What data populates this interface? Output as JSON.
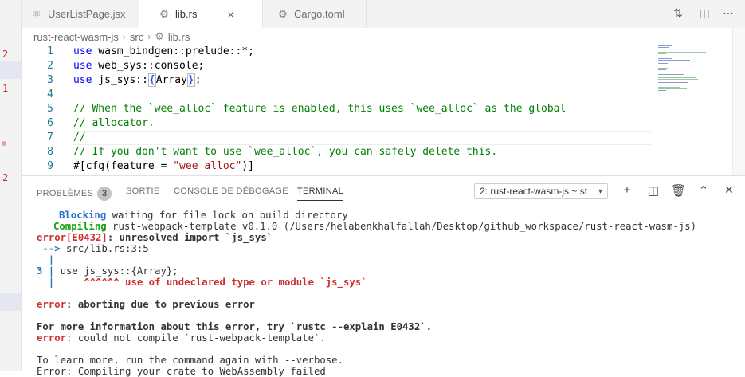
{
  "gutter": {
    "marks": [
      "2",
      "1",
      "2"
    ]
  },
  "tabs": [
    {
      "label": "UserListPage.jsx",
      "icon": "react-file-icon",
      "active": false
    },
    {
      "label": "lib.rs",
      "icon": "rust-file-icon",
      "active": true
    },
    {
      "label": "Cargo.toml",
      "icon": "gear-file-icon",
      "active": false
    }
  ],
  "tab_close_glyph": "×",
  "breadcrumb": {
    "project": "rust-react-wasm-js",
    "folder": "src",
    "file": "lib.rs",
    "separator": "›"
  },
  "editor": {
    "line_numbers": [
      "1",
      "2",
      "3",
      "4",
      "5",
      "6",
      "7",
      "8",
      "9"
    ],
    "lines": {
      "l1": {
        "kw": "use",
        "rest": " wasm_bindgen::prelude::*;"
      },
      "l2": {
        "kw": "use",
        "rest": " web_sys::console;"
      },
      "l3": {
        "kw": "use",
        "pre": " js_sys::",
        "open": "{",
        "name": "Array",
        "close": "}",
        "end": ";"
      },
      "l5": "// When the `wee_alloc` feature is enabled, this uses `wee_alloc` as the global",
      "l6": "// allocator.",
      "l7": "//",
      "l8": "// If you don't want to use `wee_alloc`, you can safely delete this.",
      "l9": {
        "pre": "#[cfg(feature = ",
        "str": "\"wee_alloc\"",
        "end": ")]"
      }
    }
  },
  "panel": {
    "tabs": {
      "problems": "PROBLÈMES",
      "problems_count": "3",
      "output": "SORTIE",
      "debug": "CONSOLE DE DÉBOGAGE",
      "terminal": "TERMINAL"
    },
    "terminal_select": "2: rust-react-wasm-js ~ st",
    "terminal_select_icon": "chevron-down-icon",
    "terminal_lines": {
      "t1_kw": "Blocking",
      "t1_rest": " waiting for file lock on build directory",
      "t2_kw": "Compiling",
      "t2_rest": " rust-webpack-template v0.1.0 (/Users/helabenkhalfallah/Desktop/github_workspace/rust-react-wasm-js)",
      "t3_kw": "error[E0432]",
      "t3_rest": ": unresolved import `js_sys`",
      "t4_arrow": " -->",
      "t4_rest": " src/lib.rs:3:5",
      "t5": "  |",
      "t6_num": "3",
      "t6_bar": " |",
      "t6_rest": " use js_sys::{Array};",
      "t7_bar": "  |",
      "t7_rest": "     ^^^^^^ use of undeclared type or module `js_sys`",
      "t8_kw": "error",
      "t8_rest": ": aborting due to previous error",
      "t9": "For more information about this error, try `rustc --explain E0432`.",
      "t10_kw": "error",
      "t10_rest": ": could not compile `rust-webpack-template`.",
      "t11": "To learn more, run the command again with --verbose.",
      "t12": "Error: Compiling your crate to WebAssembly failed"
    }
  },
  "colors": {
    "keyword": "#0000ff",
    "comment": "#008000",
    "string": "#a31515",
    "error": "#cd3131",
    "info": "#2472c8",
    "success": "#13a10e"
  }
}
